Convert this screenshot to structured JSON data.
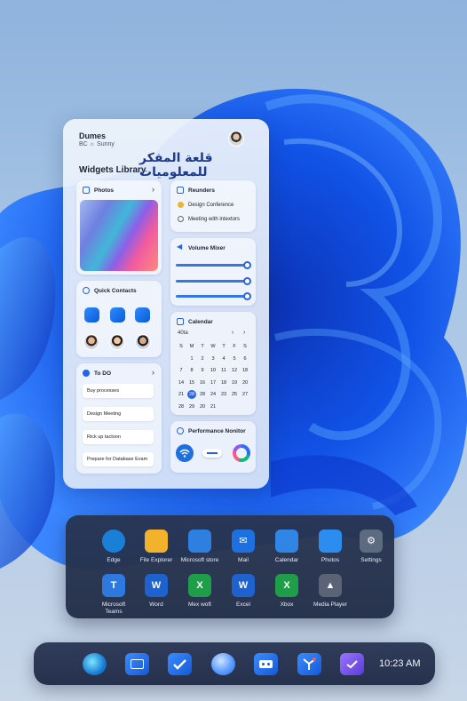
{
  "widgets_panel": {
    "user_name": "Dumes",
    "weather": "BC ☼ Sunny",
    "watermark": "قلعة المفكر للمعلوميات",
    "title": "Widgets Library",
    "photos": {
      "title": "Photos"
    },
    "quick_contacts": {
      "title": "Quick Contacts"
    },
    "todo": {
      "title": "To DO",
      "items": [
        "Buy processes",
        "Design Meeting",
        "Rick up tactoon",
        "Prepare for Database Evam"
      ]
    },
    "reminders": {
      "title": "Reunders",
      "items": [
        "Design Conference",
        "Meeting with intextors"
      ]
    },
    "volume_mixer": {
      "title": "Volume Mixer",
      "levels": [
        1.0,
        1.0,
        1.0
      ]
    },
    "calendar": {
      "title": "Calendar",
      "month_label": "40ta",
      "weekdays": [
        "S",
        "M",
        "T",
        "W",
        "T",
        "F",
        "S"
      ],
      "days": [
        "",
        "1",
        "2",
        "3",
        "4",
        "5",
        "6",
        "7",
        "8",
        "9",
        "10",
        "11",
        "12",
        "18",
        "14",
        "15",
        "16",
        "17",
        "18",
        "19",
        "20",
        "21",
        "28",
        "28",
        "24",
        "23",
        "25",
        "27",
        "28",
        "29",
        "20",
        "21",
        "",
        "",
        ""
      ],
      "today": "28"
    },
    "performance": {
      "title": "Performance Nonitor"
    }
  },
  "apps": [
    {
      "label": "Edge",
      "icon": "edge-icon",
      "color": "#1a7fd6"
    },
    {
      "label": "File Explorer",
      "icon": "folder-icon",
      "color": "#f2b22b"
    },
    {
      "label": "Microsoft store",
      "icon": "store-icon",
      "color": "#2d7fe0"
    },
    {
      "label": "Mail",
      "icon": "mail-icon",
      "color": "#1e6fe0"
    },
    {
      "label": "Calendar",
      "icon": "calendar-icon",
      "color": "#2f86e6"
    },
    {
      "label": "Photos",
      "icon": "photos-icon",
      "color": "#2d8cf0"
    },
    {
      "label": "Settings",
      "icon": "gear-icon",
      "color": "#5c6b80"
    },
    {
      "label": "Microsoft\nTeams",
      "icon": "teams-icon",
      "color": "#2e79e0"
    },
    {
      "label": "Word",
      "icon": "word-icon",
      "color": "#1e62d0"
    },
    {
      "label": "Mex woft",
      "icon": "excel-icon",
      "color": "#1f9e49"
    },
    {
      "label": "Excel",
      "icon": "word2-icon",
      "color": "#1e62d0"
    },
    {
      "label": "Xbox",
      "icon": "xbox-icon",
      "color": "#1f9e49"
    },
    {
      "label": "Media Player",
      "icon": "media-player-icon",
      "color": "#5b6477"
    }
  ],
  "taskbar": {
    "icons": [
      "edge-icon",
      "files-icon",
      "check-icon",
      "orb-icon",
      "video-icon",
      "pin-icon",
      "clock-app-icon"
    ],
    "time": "10:23 AM"
  }
}
